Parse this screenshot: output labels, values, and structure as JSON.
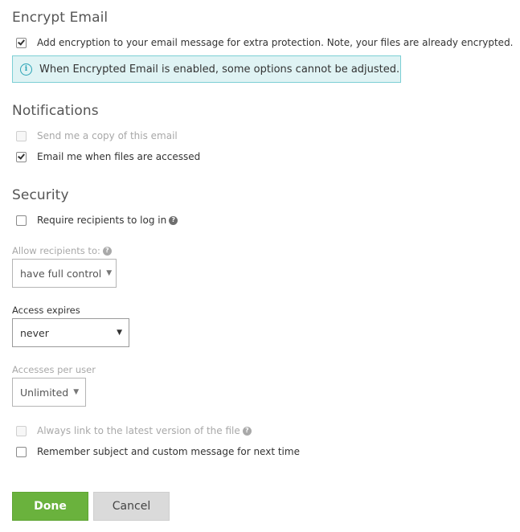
{
  "encrypt": {
    "title": "Encrypt Email",
    "checkbox_label": "Add encryption to your email message for extra protection. Note, your files are already encrypted.",
    "checkbox_checked": true,
    "info_text": "When Encrypted Email is enabled, some options cannot be adjusted.",
    "info_icon": "info-icon"
  },
  "notifications": {
    "title": "Notifications",
    "items": [
      {
        "label": "Send me a copy of this email",
        "checked": false,
        "disabled": true
      },
      {
        "label": "Email me when files are accessed",
        "checked": true,
        "disabled": false
      }
    ]
  },
  "security": {
    "title": "Security",
    "require_login_label": "Require recipients to log in",
    "require_login_checked": false,
    "help_icon": "question-icon",
    "allow_label": "Allow recipients to:",
    "allow_value": "have full control",
    "expires_label": "Access expires",
    "expires_value": "never",
    "accesses_label": "Accesses per user",
    "accesses_value": "Unlimited",
    "latest_version_label": "Always link to the latest version of the file",
    "latest_version_checked": false,
    "remember_label": "Remember subject and custom message for next time",
    "remember_checked": false
  },
  "actions": {
    "done_label": "Done",
    "cancel_label": "Cancel"
  },
  "colors": {
    "done_green": "#6ab23d",
    "info_bg": "#dff3f4",
    "info_border": "#7ccfd5",
    "info_icon": "#2aa3b5"
  },
  "glyphs": {
    "question": "?",
    "info": "i",
    "caret": "▼"
  }
}
